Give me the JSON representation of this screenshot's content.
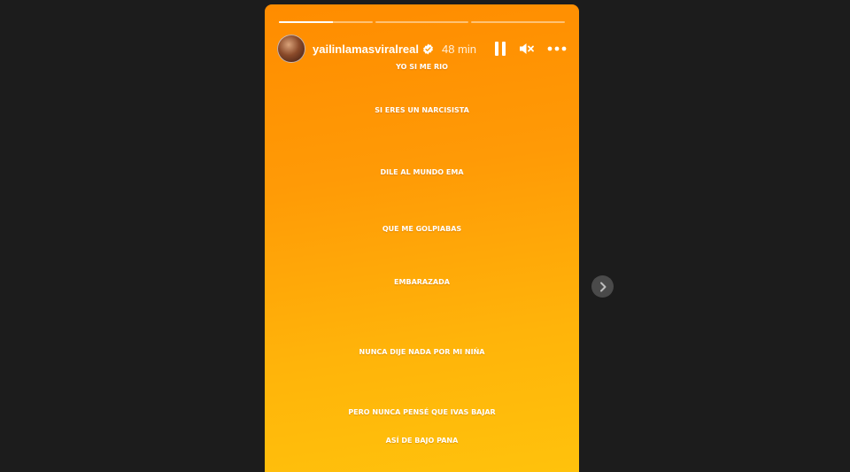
{
  "story": {
    "username": "yailinlamasviralreal",
    "time_ago": "48 min",
    "progress": [
      0.58,
      0,
      0
    ],
    "icons": {
      "verified": "verified-badge-icon",
      "pause": "pause-icon",
      "mute": "mute-icon",
      "more": "more-options-icon",
      "next": "chevron-right-icon"
    },
    "lines": [
      "YO SI ME RIO",
      "SI ERES UN NARCISISTA",
      "DILE AL MUNDO EMA",
      "QUE ME GOLPIABAS",
      "EMBARAZADA",
      "NUNCA DIJE NADA POR MI NIŃA",
      "PERO NUNCA PENSÉ QUE IVAS BAJAR",
      "ASÍ DE BAJO PANA"
    ]
  },
  "colors": {
    "background": "#1c1c1c",
    "gradient_top": "#ff8c00",
    "gradient_bottom": "#ffc30c",
    "text": "#ffffff"
  }
}
